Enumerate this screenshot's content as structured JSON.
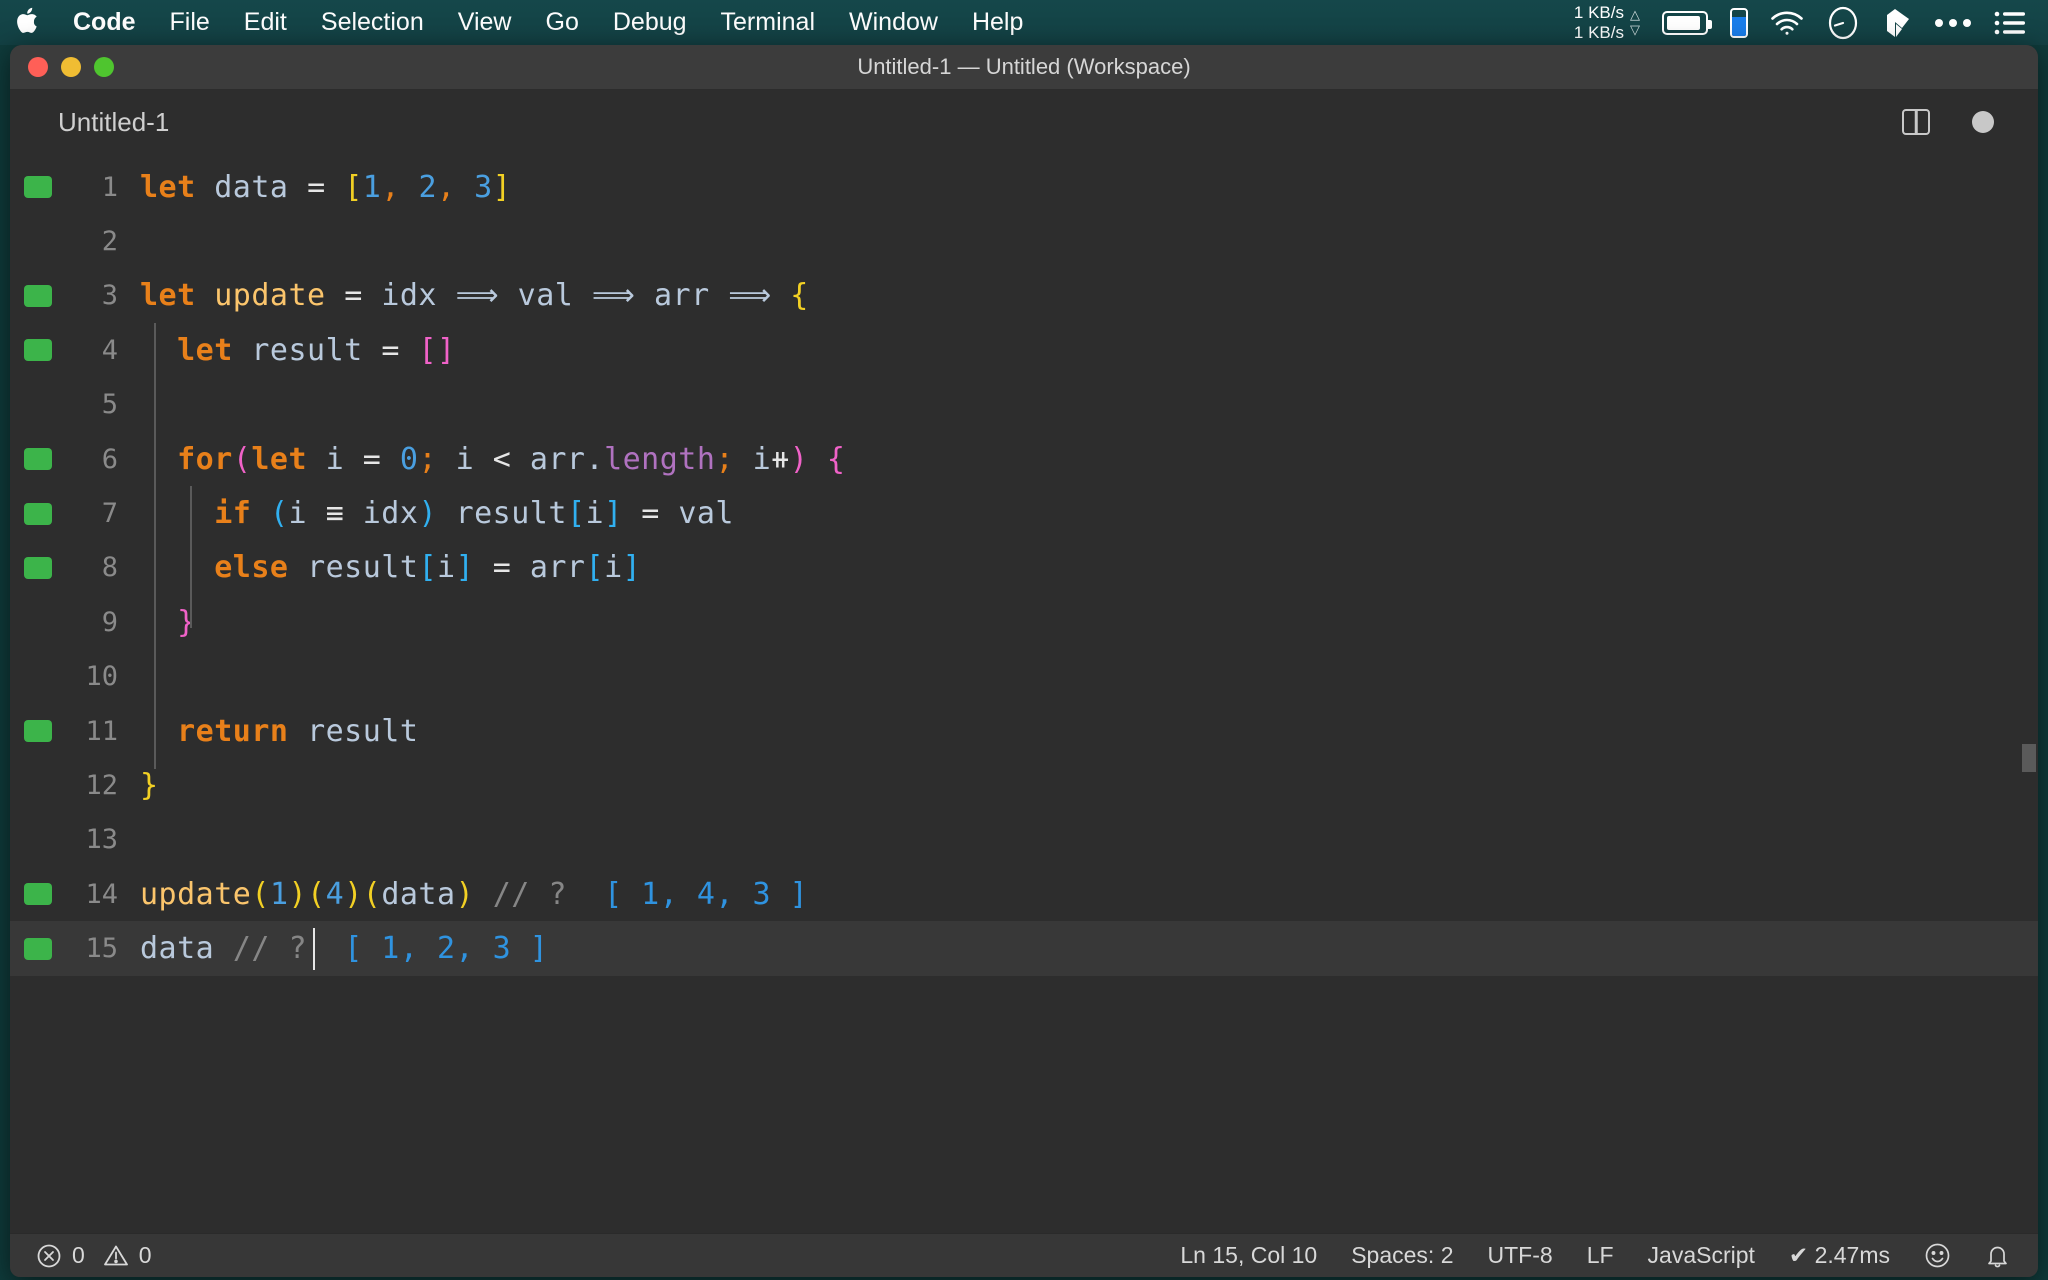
{
  "menubar": {
    "apple_icon": "apple-logo-icon",
    "items": [
      {
        "label": "Code",
        "bold": true
      },
      {
        "label": "File",
        "bold": false
      },
      {
        "label": "Edit",
        "bold": false
      },
      {
        "label": "Selection",
        "bold": false
      },
      {
        "label": "View",
        "bold": false
      },
      {
        "label": "Go",
        "bold": false
      },
      {
        "label": "Debug",
        "bold": false
      },
      {
        "label": "Terminal",
        "bold": false
      },
      {
        "label": "Window",
        "bold": false
      },
      {
        "label": "Help",
        "bold": false
      }
    ],
    "status": {
      "net_up": "1 KB/s",
      "net_down": "1 KB/s",
      "up_arrow": "△",
      "down_arrow": "▽",
      "icons": [
        "battery-icon",
        "phone-battery-icon",
        "wifi-icon",
        "speedometer-icon",
        "dropbox-icon",
        "ellipsis-icon",
        "list-menu-icon"
      ]
    }
  },
  "window": {
    "title": "Untitled-1 — Untitled (Workspace)",
    "traffic_lights": [
      "close-button",
      "minimize-button",
      "maximize-button"
    ]
  },
  "tabbar": {
    "tab_label": "Untitled-1",
    "actions": [
      "split-editor-icon",
      "unsaved-dot-icon"
    ]
  },
  "editor": {
    "accent_colors": {
      "keyword": "#e8801a",
      "function": "#fbc56c",
      "variable": "#b9c9dc",
      "number": "#4a9fe0",
      "property": "#b072c0",
      "comment": "#868686",
      "bracket_yellow": "#f2d024",
      "bracket_magenta": "#f062c8",
      "bracket_cyan": "#31b0f0",
      "coverage_green": "#3cb44a",
      "background": "#2d2d2d",
      "active_line": "#383838"
    },
    "lines": [
      {
        "num": "1",
        "covered": true,
        "active": false,
        "indent": 0,
        "tokens": [
          {
            "t": "let",
            "c": "kw"
          },
          {
            "t": " ",
            "c": "op"
          },
          {
            "t": "data",
            "c": "var"
          },
          {
            "t": " ",
            "c": "op"
          },
          {
            "t": "=",
            "c": "op"
          },
          {
            "t": " ",
            "c": "op"
          },
          {
            "t": "[",
            "c": "punct-y"
          },
          {
            "t": "1",
            "c": "num"
          },
          {
            "t": ",",
            "c": "punct-o"
          },
          {
            "t": " ",
            "c": "op"
          },
          {
            "t": "2",
            "c": "num"
          },
          {
            "t": ",",
            "c": "punct-o"
          },
          {
            "t": " ",
            "c": "op"
          },
          {
            "t": "3",
            "c": "num"
          },
          {
            "t": "]",
            "c": "punct-y"
          }
        ]
      },
      {
        "num": "2",
        "covered": false,
        "active": false,
        "indent": 0,
        "tokens": []
      },
      {
        "num": "3",
        "covered": true,
        "active": false,
        "indent": 0,
        "tokens": [
          {
            "t": "let",
            "c": "kw"
          },
          {
            "t": " ",
            "c": "op"
          },
          {
            "t": "update",
            "c": "fn"
          },
          {
            "t": " ",
            "c": "op"
          },
          {
            "t": "=",
            "c": "op"
          },
          {
            "t": " ",
            "c": "op"
          },
          {
            "t": "idx",
            "c": "var"
          },
          {
            "t": " ",
            "c": "op"
          },
          {
            "t": "⟹",
            "c": "var"
          },
          {
            "t": " ",
            "c": "op"
          },
          {
            "t": "val",
            "c": "var"
          },
          {
            "t": " ",
            "c": "op"
          },
          {
            "t": "⟹",
            "c": "var"
          },
          {
            "t": " ",
            "c": "op"
          },
          {
            "t": "arr",
            "c": "var"
          },
          {
            "t": " ",
            "c": "op"
          },
          {
            "t": "⟹",
            "c": "var"
          },
          {
            "t": " ",
            "c": "op"
          },
          {
            "t": "{",
            "c": "punct-y"
          }
        ]
      },
      {
        "num": "4",
        "covered": true,
        "active": false,
        "indent": 1,
        "tokens": [
          {
            "t": "  ",
            "c": "op"
          },
          {
            "t": "let",
            "c": "kw"
          },
          {
            "t": " ",
            "c": "op"
          },
          {
            "t": "result",
            "c": "var"
          },
          {
            "t": " ",
            "c": "op"
          },
          {
            "t": "=",
            "c": "op"
          },
          {
            "t": " ",
            "c": "op"
          },
          {
            "t": "[]",
            "c": "punct-m"
          }
        ]
      },
      {
        "num": "5",
        "covered": false,
        "active": false,
        "indent": 1,
        "tokens": []
      },
      {
        "num": "6",
        "covered": true,
        "active": false,
        "indent": 1,
        "tokens": [
          {
            "t": "  ",
            "c": "op"
          },
          {
            "t": "for",
            "c": "kw"
          },
          {
            "t": "(",
            "c": "punct-m"
          },
          {
            "t": "let",
            "c": "kw"
          },
          {
            "t": " ",
            "c": "op"
          },
          {
            "t": "i",
            "c": "var"
          },
          {
            "t": " ",
            "c": "op"
          },
          {
            "t": "=",
            "c": "op"
          },
          {
            "t": " ",
            "c": "op"
          },
          {
            "t": "0",
            "c": "num"
          },
          {
            "t": ";",
            "c": "punct-o"
          },
          {
            "t": " ",
            "c": "op"
          },
          {
            "t": "i",
            "c": "var"
          },
          {
            "t": " ",
            "c": "op"
          },
          {
            "t": "<",
            "c": "op"
          },
          {
            "t": " ",
            "c": "op"
          },
          {
            "t": "arr",
            "c": "var"
          },
          {
            "t": ".",
            "c": "var"
          },
          {
            "t": "length",
            "c": "prop"
          },
          {
            "t": ";",
            "c": "punct-o"
          },
          {
            "t": " ",
            "c": "op"
          },
          {
            "t": "i",
            "c": "var"
          },
          {
            "t": "⧺",
            "c": "op"
          },
          {
            "t": ")",
            "c": "punct-m"
          },
          {
            "t": " ",
            "c": "op"
          },
          {
            "t": "{",
            "c": "punct-m"
          }
        ]
      },
      {
        "num": "7",
        "covered": true,
        "active": false,
        "indent": 2,
        "tokens": [
          {
            "t": "    ",
            "c": "op"
          },
          {
            "t": "if",
            "c": "kw"
          },
          {
            "t": " ",
            "c": "op"
          },
          {
            "t": "(",
            "c": "punct-c"
          },
          {
            "t": "i",
            "c": "var"
          },
          {
            "t": " ",
            "c": "op"
          },
          {
            "t": "≡",
            "c": "op"
          },
          {
            "t": " ",
            "c": "op"
          },
          {
            "t": "idx",
            "c": "var"
          },
          {
            "t": ")",
            "c": "punct-c"
          },
          {
            "t": " ",
            "c": "op"
          },
          {
            "t": "result",
            "c": "var"
          },
          {
            "t": "[",
            "c": "punct-c"
          },
          {
            "t": "i",
            "c": "var"
          },
          {
            "t": "]",
            "c": "punct-c"
          },
          {
            "t": " ",
            "c": "op"
          },
          {
            "t": "=",
            "c": "op"
          },
          {
            "t": " ",
            "c": "op"
          },
          {
            "t": "val",
            "c": "var"
          }
        ]
      },
      {
        "num": "8",
        "covered": true,
        "active": false,
        "indent": 2,
        "tokens": [
          {
            "t": "    ",
            "c": "op"
          },
          {
            "t": "else",
            "c": "kw"
          },
          {
            "t": " ",
            "c": "op"
          },
          {
            "t": "result",
            "c": "var"
          },
          {
            "t": "[",
            "c": "punct-c"
          },
          {
            "t": "i",
            "c": "var"
          },
          {
            "t": "]",
            "c": "punct-c"
          },
          {
            "t": " ",
            "c": "op"
          },
          {
            "t": "=",
            "c": "op"
          },
          {
            "t": " ",
            "c": "op"
          },
          {
            "t": "arr",
            "c": "var"
          },
          {
            "t": "[",
            "c": "punct-c"
          },
          {
            "t": "i",
            "c": "var"
          },
          {
            "t": "]",
            "c": "punct-c"
          }
        ]
      },
      {
        "num": "9",
        "covered": false,
        "active": false,
        "indent": 1,
        "tokens": [
          {
            "t": "  ",
            "c": "op"
          },
          {
            "t": "}",
            "c": "punct-m"
          }
        ]
      },
      {
        "num": "10",
        "covered": false,
        "active": false,
        "indent": 1,
        "tokens": []
      },
      {
        "num": "11",
        "covered": true,
        "active": false,
        "indent": 1,
        "tokens": [
          {
            "t": "  ",
            "c": "op"
          },
          {
            "t": "return",
            "c": "kw"
          },
          {
            "t": " ",
            "c": "op"
          },
          {
            "t": "result",
            "c": "var"
          }
        ]
      },
      {
        "num": "12",
        "covered": false,
        "active": false,
        "indent": 0,
        "tokens": [
          {
            "t": "}",
            "c": "punct-y"
          }
        ]
      },
      {
        "num": "13",
        "covered": false,
        "active": false,
        "indent": 0,
        "tokens": []
      },
      {
        "num": "14",
        "covered": true,
        "active": false,
        "indent": 0,
        "tokens": [
          {
            "t": "update",
            "c": "fn"
          },
          {
            "t": "(",
            "c": "punct-y"
          },
          {
            "t": "1",
            "c": "num"
          },
          {
            "t": ")",
            "c": "punct-y"
          },
          {
            "t": "(",
            "c": "punct-y"
          },
          {
            "t": "4",
            "c": "num"
          },
          {
            "t": ")",
            "c": "punct-y"
          },
          {
            "t": "(",
            "c": "punct-y"
          },
          {
            "t": "data",
            "c": "var"
          },
          {
            "t": ")",
            "c": "punct-y"
          },
          {
            "t": " ",
            "c": "op"
          },
          {
            "t": "// ?",
            "c": "cmt"
          },
          {
            "t": "  ",
            "c": "op"
          },
          {
            "t": "[ 1, 4, 3 ]",
            "c": "result"
          }
        ]
      },
      {
        "num": "15",
        "covered": true,
        "active": true,
        "indent": 0,
        "tokens": [
          {
            "t": "data",
            "c": "var"
          },
          {
            "t": " ",
            "c": "op"
          },
          {
            "t": "// ?",
            "c": "cmt"
          },
          {
            "t": "  ",
            "c": "op"
          },
          {
            "t": "[ 1, 2, 3 ]",
            "c": "result"
          }
        ]
      }
    ]
  },
  "statusbar": {
    "errors_icon": "error-circle-icon",
    "errors": "0",
    "warnings_icon": "warning-triangle-icon",
    "warnings": "0",
    "cursor_position": "Ln 15, Col 10",
    "indentation": "Spaces: 2",
    "encoding": "UTF-8",
    "eol": "LF",
    "language": "JavaScript",
    "run_status": "✔ 2.47ms",
    "feedback_icon": "smiley-icon",
    "notifications_icon": "bell-icon"
  }
}
